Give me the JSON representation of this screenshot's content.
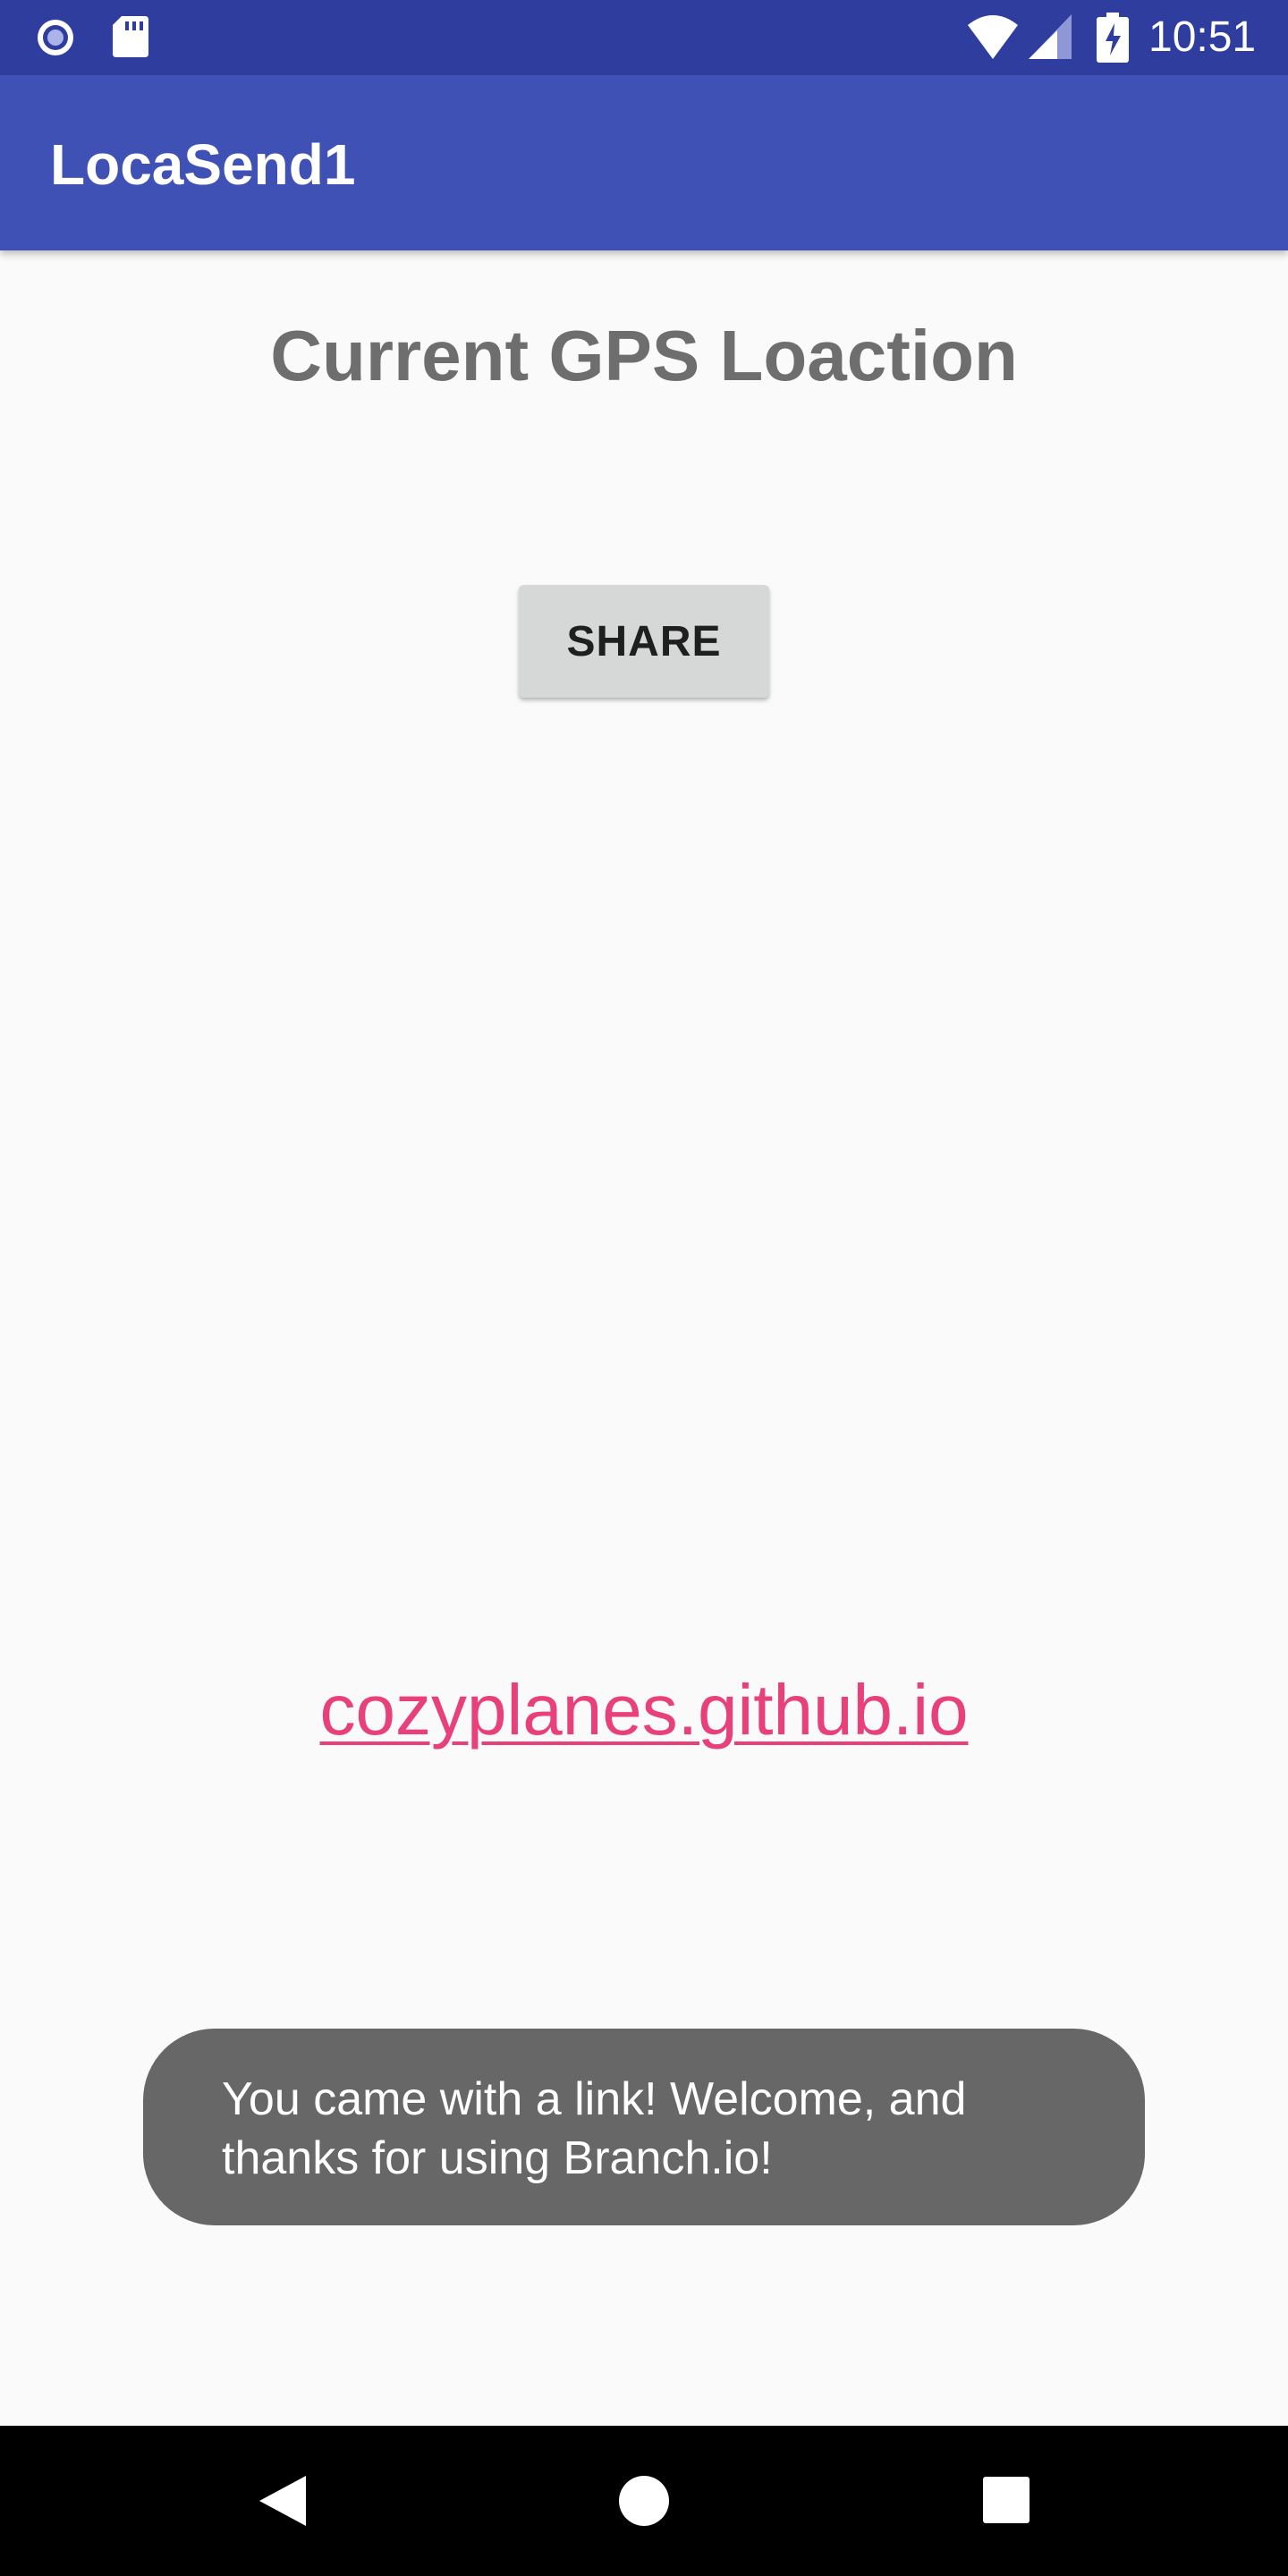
{
  "status_bar": {
    "time": "10:51",
    "icons": [
      "radio-notification-icon",
      "sd-card-icon",
      "wifi-icon",
      "cell-signal-icon",
      "battery-charging-icon"
    ]
  },
  "app_bar": {
    "title": "LocaSend1"
  },
  "main": {
    "heading": "Current GPS Loaction",
    "share_button_label": "SHARE",
    "link_text": "cozyplanes.github.io"
  },
  "toast": {
    "message": "You came with a link! Welcome, and\nthanks for using Branch.io!"
  },
  "nav_bar": {
    "icons": [
      "back-icon",
      "home-icon",
      "recents-icon"
    ]
  },
  "colors": {
    "status_bar": "#2f3e9e",
    "app_bar": "#3f51b5",
    "background": "#fafafa",
    "heading_text": "#6e6e6e",
    "button_bg": "#d6d7d7",
    "link": "#e8407a",
    "toast_bg": "#676767",
    "nav_bar": "#000000"
  }
}
